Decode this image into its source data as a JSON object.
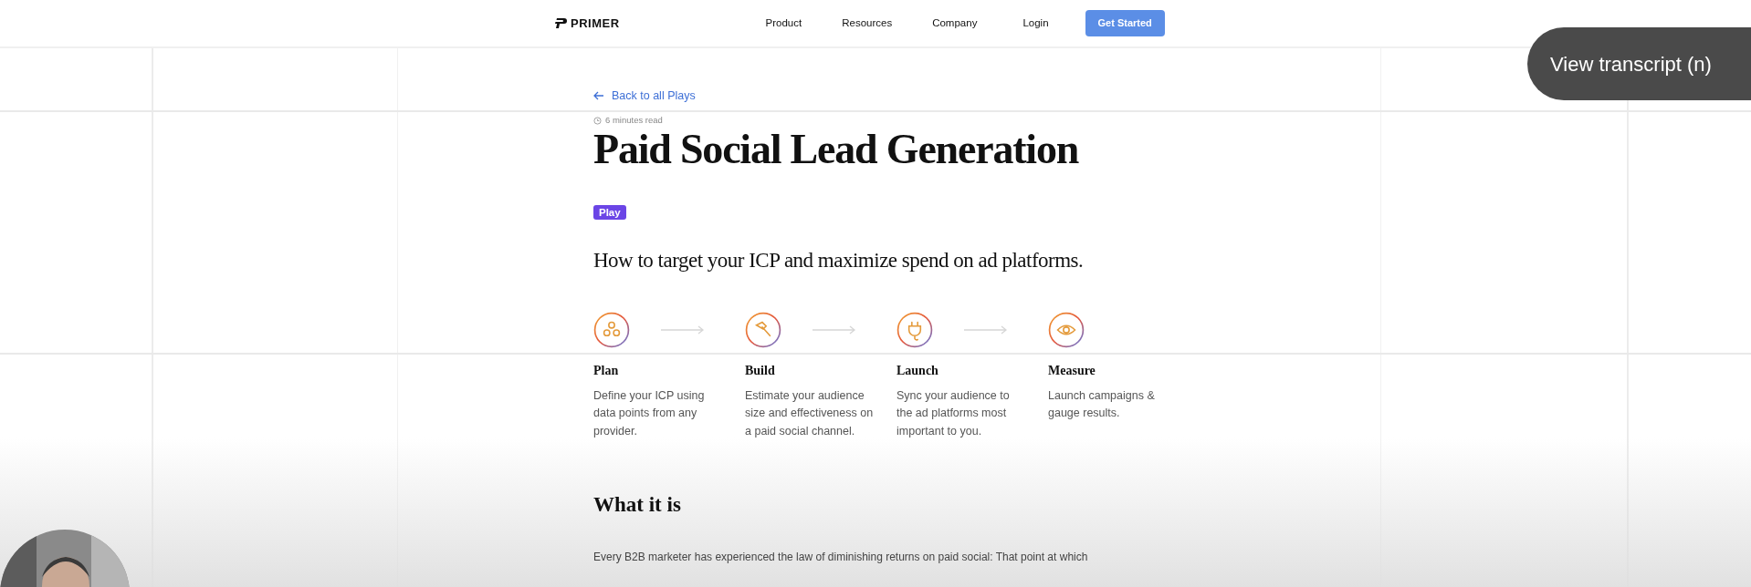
{
  "navbar": {
    "logo": "PRIMER",
    "links": [
      "Product",
      "Resources",
      "Company",
      "Login"
    ],
    "cta": "Get Started"
  },
  "back_link": "Back to all Plays",
  "read_time": "6 minutes read",
  "title": "Paid Social Lead Generation",
  "badge": "Play",
  "subtitle": "How to target your ICP and maximize spend on ad platforms.",
  "steps": [
    {
      "title": "Plan",
      "description": "Define your ICP using data points from any provider."
    },
    {
      "title": "Build",
      "description": "Estimate your audience size and effectiveness on a paid social channel."
    },
    {
      "title": "Launch",
      "description": "Sync your audience to the ad platforms most important to you."
    },
    {
      "title": "Measure",
      "description": "Launch campaigns & gauge results."
    }
  ],
  "section_heading": "What it is",
  "paragraph": "Every B2B marketer has experienced the law of diminishing returns on paid social: That point at which",
  "transcript_button": "View transcript (n)"
}
